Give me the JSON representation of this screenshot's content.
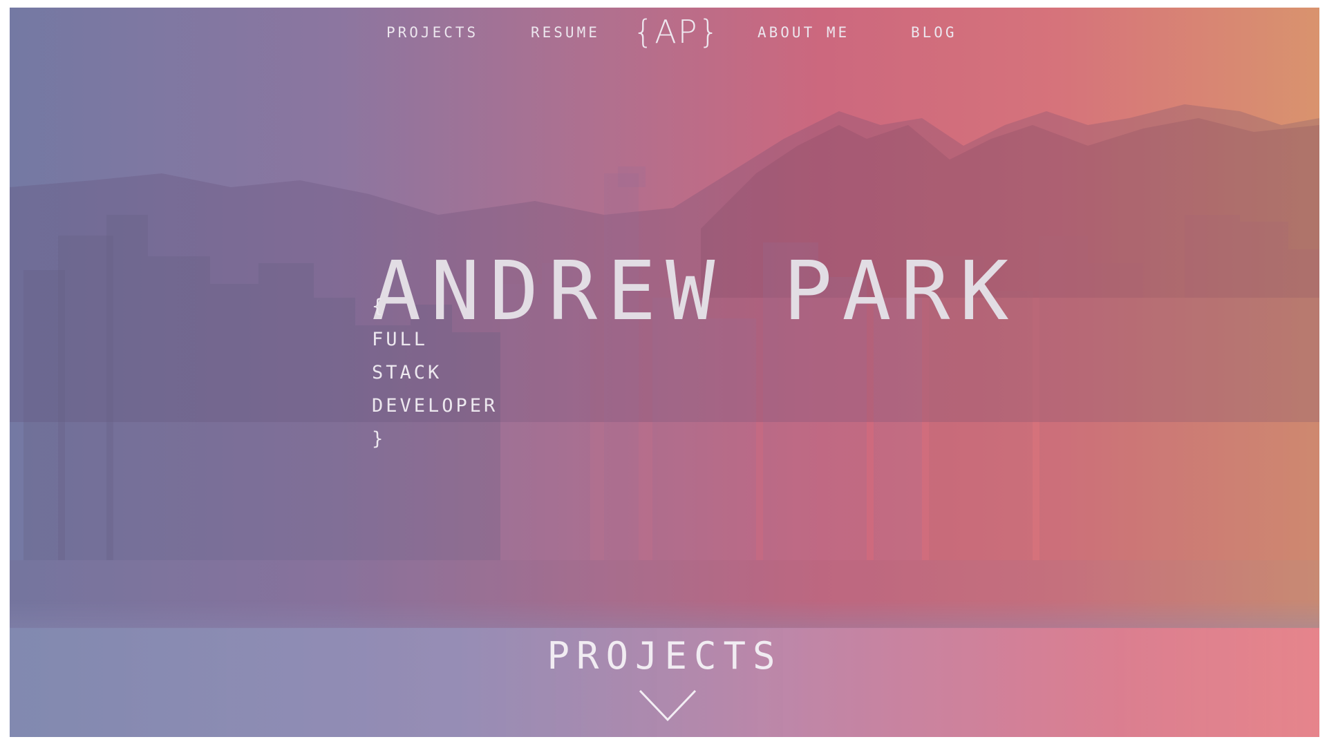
{
  "nav": {
    "projects": "PROJECTS",
    "resume": "RESUME",
    "logo": "{AP}",
    "about": "ABOUT ME",
    "blog": "BLOG"
  },
  "hero": {
    "name": "ANDREW PARK",
    "role_open": "{",
    "role_lines": [
      "FULL",
      "STACK",
      "DEVELOPER"
    ],
    "role_close": "}"
  },
  "section": {
    "title": "PROJECTS",
    "scroll_icon": "chevron-down-icon"
  },
  "colors": {
    "gradient_left": "#7479a3",
    "gradient_mid": "#cc687e",
    "gradient_right": "#d9936e",
    "text": "#e9e4ec"
  }
}
